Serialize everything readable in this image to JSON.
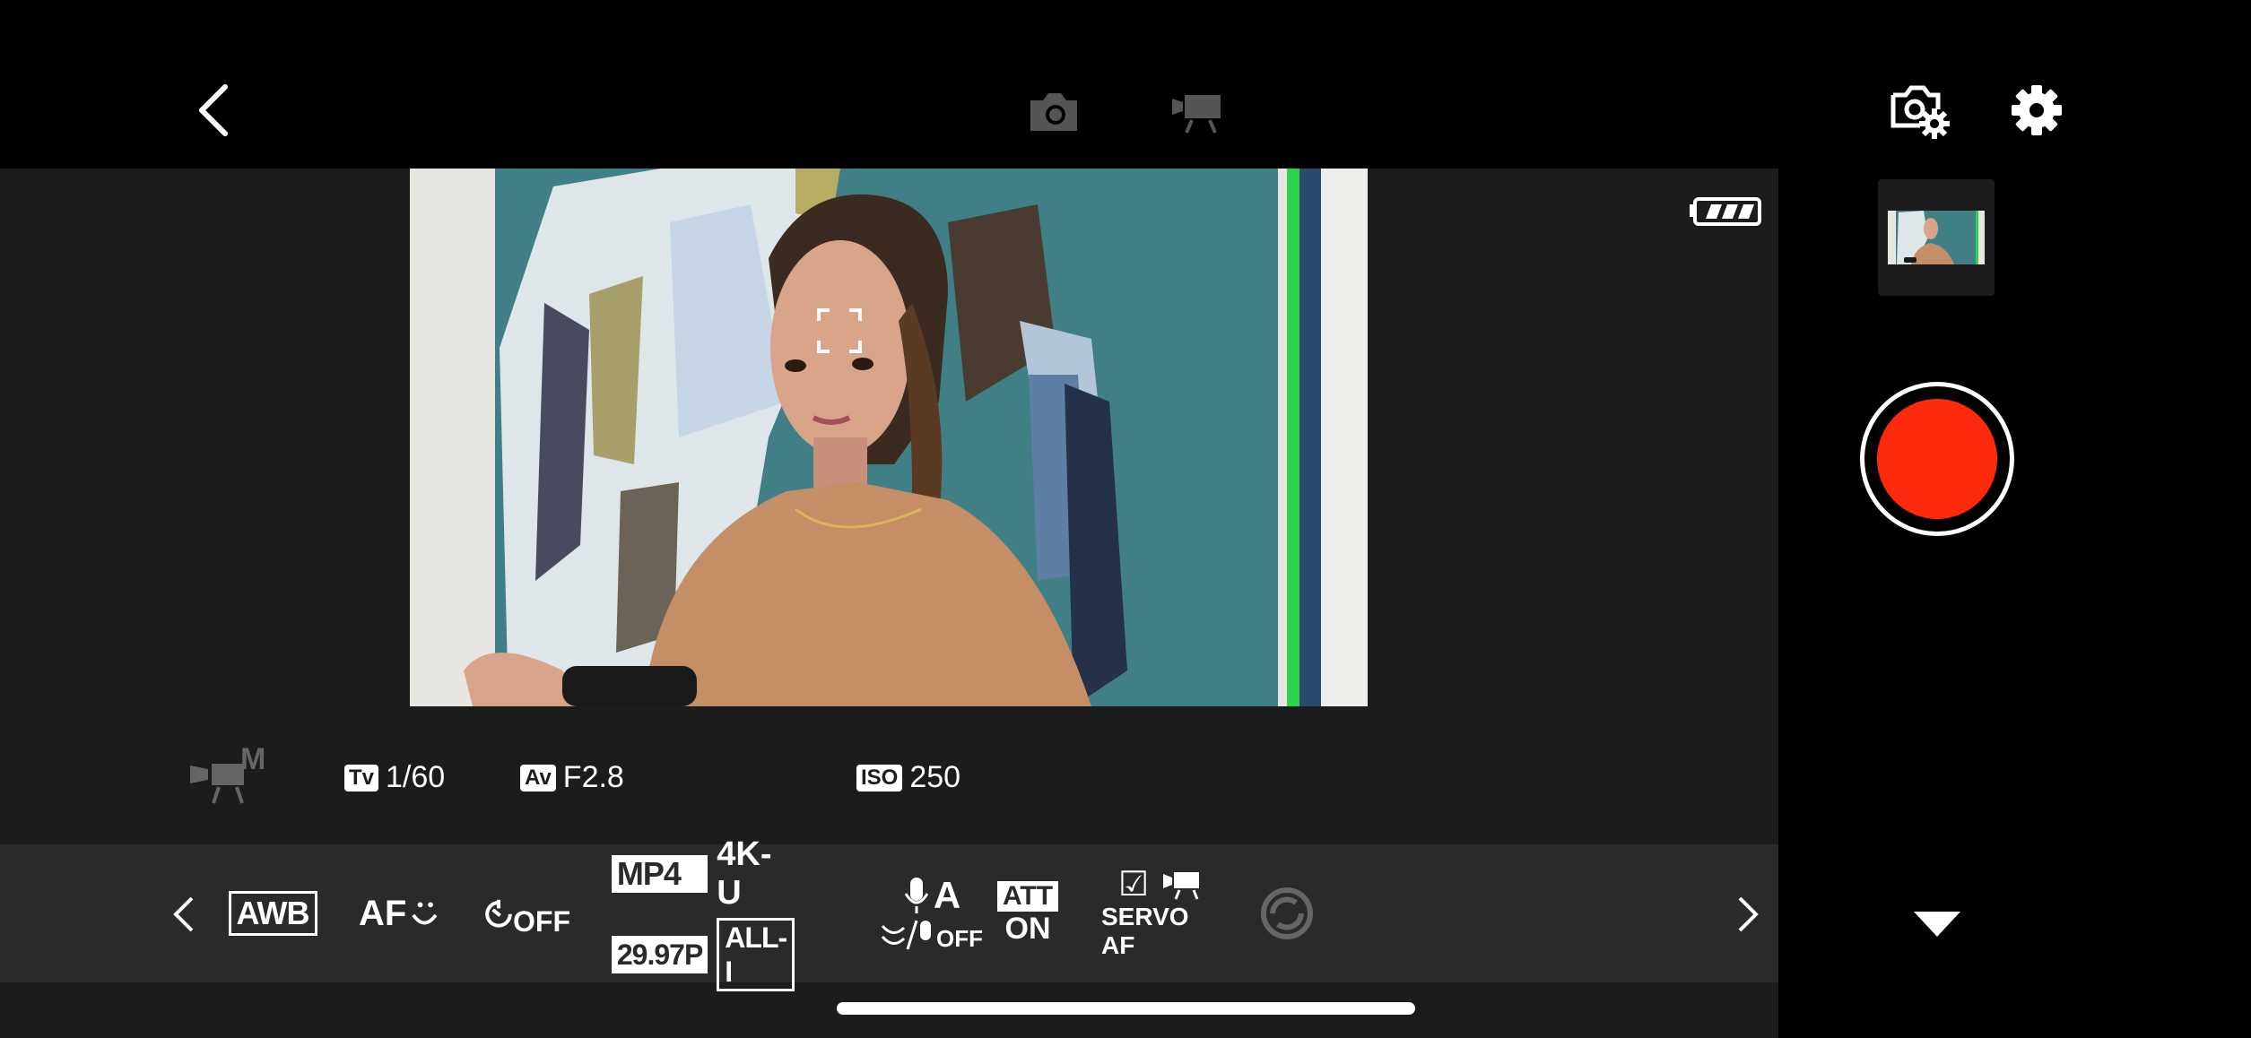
{
  "topbar": {
    "back_icon": "chevron-left-icon",
    "still_mode_icon": "camera-icon",
    "movie_mode_icon": "movie-camera-icon",
    "camera_settings_icon": "camera-gear-icon",
    "settings_icon": "gear-icon"
  },
  "liveview": {
    "battery_icon": "battery-full-icon",
    "af_frame_icon": "face-detect-frame-icon"
  },
  "info": {
    "mode_icon": "movie-manual-mode-icon",
    "mode_suffix": "M",
    "tv_tag": "Tv",
    "tv_value": "1/60",
    "av_tag": "Av",
    "av_value": "F2.8",
    "iso_tag": "ISO",
    "iso_value": "250"
  },
  "settings": {
    "prev_icon": "chevron-left-icon",
    "next_icon": "chevron-right-icon",
    "white_balance": "AWB",
    "af_method": "AF",
    "af_method_icon": "face-tracking-icon",
    "self_timer": "OFF",
    "self_timer_icon": "self-timer-icon",
    "file_format": "MP4",
    "resolution": "4K-U",
    "frame_rate": "29.97P",
    "compression": "ALL-I",
    "audio_top": "A",
    "audio_bottom": "OFF",
    "audio_icon": "microphone-icon",
    "attenuator_top": "ATT",
    "attenuator_bottom": "ON",
    "servo_label": "SERVO AF",
    "servo_check": "☑",
    "servo_icon": "movie-camera-icon",
    "stabilizer_icon": "image-stabilizer-icon"
  },
  "right": {
    "thumbnail_icon": "last-shot-thumbnail",
    "record_icon": "record-button",
    "collapse_icon": "triangle-down-icon"
  },
  "colors": {
    "record": "#ff2a0e",
    "panel": "#1c1c1c",
    "settings_bar": "#2a2a2a"
  }
}
